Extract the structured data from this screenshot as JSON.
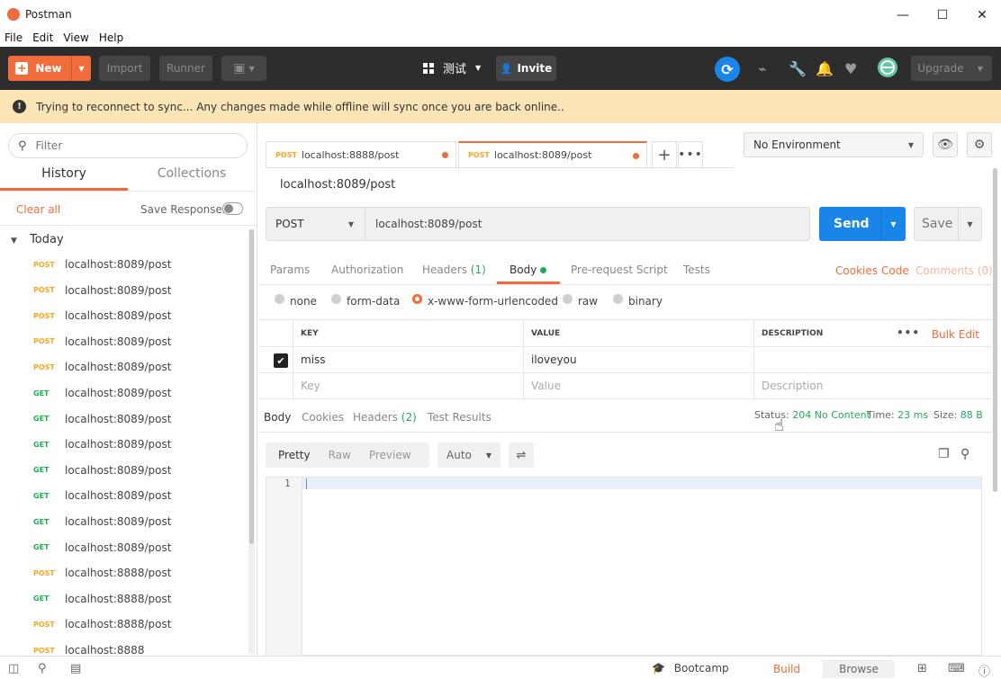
{
  "window": {
    "title": "Postman",
    "minimize": "—",
    "maximize": "☐",
    "close": "✕"
  },
  "menu": [
    "File",
    "Edit",
    "View",
    "Help"
  ],
  "toolbar": {
    "new_label": "New",
    "import_label": "Import",
    "runner_label": "Runner",
    "workspace_name": "测试",
    "invite_label": "Invite",
    "upgrade_label": "Upgrade"
  },
  "banner": {
    "message": "Trying to reconnect to sync... Any changes made while offline will sync once you are back online.."
  },
  "sidebar": {
    "filter_placeholder": "Filter",
    "tabs": [
      {
        "label": "History",
        "active": true
      },
      {
        "label": "Collections",
        "active": false
      }
    ],
    "clear_all": "Clear all",
    "save_responses": "Save Responses",
    "group_label": "Today",
    "history": [
      {
        "method": "POST",
        "url": "localhost:8089/post"
      },
      {
        "method": "POST",
        "url": "localhost:8089/post"
      },
      {
        "method": "POST",
        "url": "localhost:8089/post"
      },
      {
        "method": "POST",
        "url": "localhost:8089/post"
      },
      {
        "method": "POST",
        "url": "localhost:8089/post"
      },
      {
        "method": "GET",
        "url": "localhost:8089/post"
      },
      {
        "method": "GET",
        "url": "localhost:8089/post"
      },
      {
        "method": "GET",
        "url": "localhost:8089/post"
      },
      {
        "method": "GET",
        "url": "localhost:8089/post"
      },
      {
        "method": "GET",
        "url": "localhost:8089/post"
      },
      {
        "method": "GET",
        "url": "localhost:8089/post"
      },
      {
        "method": "GET",
        "url": "localhost:8089/post"
      },
      {
        "method": "POST",
        "url": "localhost:8888/post"
      },
      {
        "method": "GET",
        "url": "localhost:8888/post"
      },
      {
        "method": "POST",
        "url": "localhost:8888/post"
      },
      {
        "method": "POST",
        "url": "localhost:8888"
      }
    ]
  },
  "request_tabs": [
    {
      "method": "POST",
      "url": "localhost:8888/post",
      "active": false
    },
    {
      "method": "POST",
      "url": "localhost:8089/post",
      "active": true
    }
  ],
  "environment": {
    "selected": "No Environment"
  },
  "request": {
    "name": "localhost:8089/post",
    "method": "POST",
    "url": "localhost:8089/post",
    "send_label": "Send",
    "save_label": "Save",
    "tabs": {
      "params": "Params",
      "authorization": "Authorization",
      "headers": "Headers",
      "headers_count": "(1)",
      "body": "Body",
      "prerequest": "Pre-request Script",
      "tests": "Tests"
    },
    "links": {
      "cookies": "Cookies",
      "code": "Code",
      "comments": "Comments (0)"
    },
    "body_modes": [
      {
        "label": "none",
        "selected": false
      },
      {
        "label": "form-data",
        "selected": false
      },
      {
        "label": "x-www-form-urlencoded",
        "selected": true
      },
      {
        "label": "raw",
        "selected": false
      },
      {
        "label": "binary",
        "selected": false
      }
    ],
    "table": {
      "headers": {
        "key": "KEY",
        "value": "VALUE",
        "description": "DESCRIPTION",
        "bulk_edit": "Bulk Edit"
      },
      "rows": [
        {
          "key": "miss",
          "value": "iloveyou",
          "description": "",
          "checked": true
        }
      ],
      "placeholder": {
        "key": "Key",
        "value": "Value",
        "description": "Description"
      }
    }
  },
  "response": {
    "tabs": {
      "body": "Body",
      "cookies": "Cookies",
      "headers": "Headers",
      "headers_count": "(2)",
      "test_results": "Test Results"
    },
    "status_label": "Status:",
    "status_value": "204 No Content",
    "time_label": "Time:",
    "time_value": "23 ms",
    "size_label": "Size:",
    "size_value": "88 B",
    "view_modes": [
      {
        "label": "Pretty",
        "active": true
      },
      {
        "label": "Raw",
        "active": false
      },
      {
        "label": "Preview",
        "active": false
      }
    ],
    "format": "Auto",
    "line_number": "1"
  },
  "statusbar": {
    "bootcamp": "Bootcamp",
    "build": "Build",
    "browse": "Browse"
  }
}
